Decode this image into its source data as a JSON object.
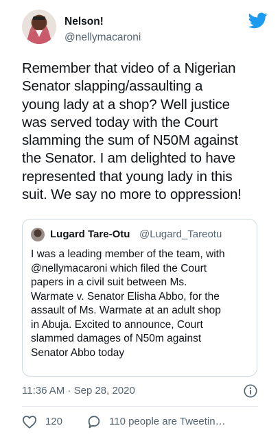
{
  "author": {
    "name": "Nelson!",
    "handle": "@nellymacaroni",
    "avatar_icon": "profile-photo"
  },
  "brand": {
    "icon": "twitter-bird-icon",
    "color": "#1d9bf0"
  },
  "tweet": {
    "lines": [
      "Remember that video of a Nigerian",
      "Senator slapping/assaulting a",
      "young lady at a shop? Well justice",
      "was served today with the Court",
      "slamming the sum of N50M against",
      "the Senator. I am delighted to have",
      "represented that young lady in this",
      "suit. We say no more to oppression!"
    ]
  },
  "quoted": {
    "name": "Lugard Tare-Otu",
    "handle": "@Lugard_Tareotu",
    "lines": [
      "I was a leading member of the team, with",
      "@nellymacaroni which filed the Court",
      "papers in a civil suit between Ms.",
      "Warmate v. Senator Elisha Abbo, for the",
      "assault of Ms. Warmate at an adult shop",
      "in Abuja. Excited to announce, Court",
      "slammed damages of N50m against",
      "Senator Abbo today"
    ]
  },
  "meta": {
    "timestamp": "11:36 AM · Sep 28, 2020",
    "info_icon": "info-icon"
  },
  "actions": {
    "like_count": "120",
    "reply_label": "110 people are Tweetin…"
  }
}
